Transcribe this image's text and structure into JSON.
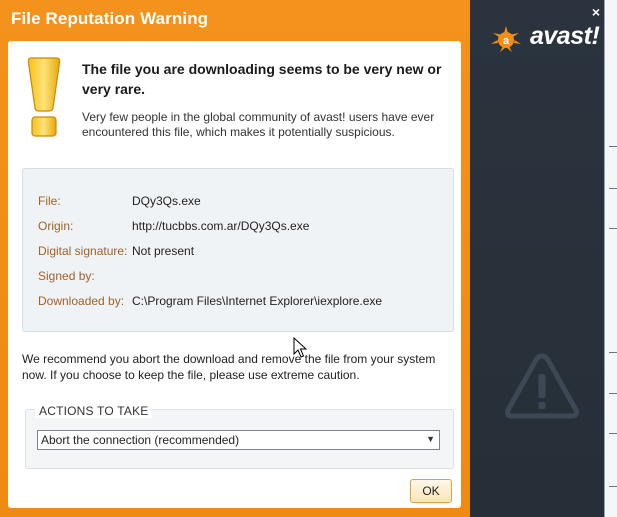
{
  "window": {
    "title": "File Reputation Warning",
    "close_glyph": "×"
  },
  "brand": {
    "logo_text": "avast!",
    "accent_color": "#f28d17",
    "sidebar_color": "#28313b"
  },
  "message": {
    "headline": "The file you are downloading seems to be very new or very rare.",
    "description": "Very few people in the global community of avast! users have ever encountered this file, which makes it potentially suspicious."
  },
  "file_info": [
    {
      "label": "File:",
      "value": "DQy3Qs.exe"
    },
    {
      "label": "Origin:",
      "value": "http://tucbbs.com.ar/DQy3Qs.exe"
    },
    {
      "label": "Digital signature:",
      "value": "Not present"
    },
    {
      "label": "Signed by:",
      "value": ""
    },
    {
      "label": "Downloaded by:",
      "value": "C:\\Program Files\\Internet Explorer\\iexplore.exe"
    }
  ],
  "recommendation": "We recommend you abort the download and remove the file from your system now. If you choose to keep the file, please use extreme caution.",
  "actions": {
    "title": "ACTIONS TO TAKE",
    "selected": "Abort the connection (recommended)"
  },
  "buttons": {
    "ok": "OK"
  },
  "icons": {
    "exclamation": "exclamation-icon",
    "warning": "warning-triangle-icon",
    "close": "close-icon",
    "dropdown": "chevron-down-icon",
    "cursor": "mouse-cursor-icon"
  }
}
